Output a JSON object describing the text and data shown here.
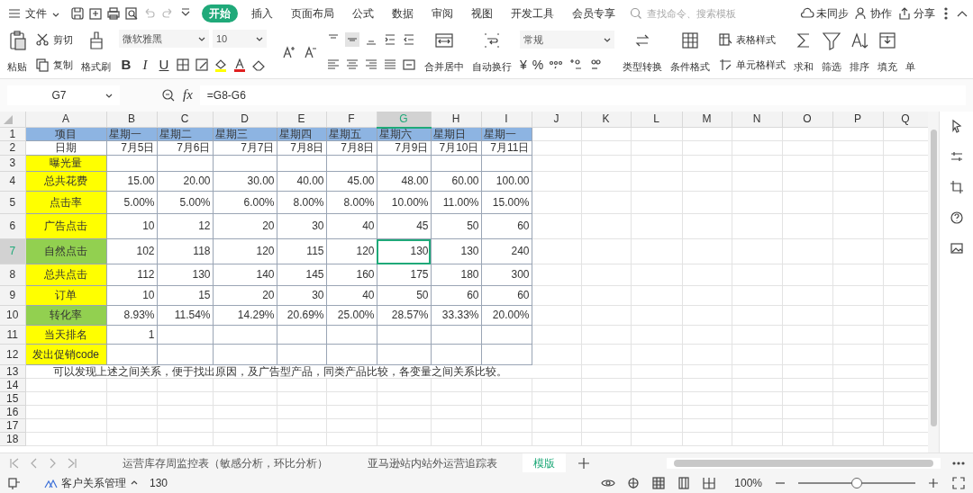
{
  "menu_bar": {
    "file": "文件",
    "tabs": [
      {
        "label": "开始",
        "selected": true
      },
      {
        "label": "插入",
        "selected": false
      },
      {
        "label": "页面布局",
        "selected": false
      },
      {
        "label": "公式",
        "selected": false
      },
      {
        "label": "数据",
        "selected": false
      },
      {
        "label": "审阅",
        "selected": false
      },
      {
        "label": "视图",
        "selected": false
      },
      {
        "label": "开发工具",
        "selected": false
      },
      {
        "label": "会员专享",
        "selected": false
      }
    ],
    "search": {
      "placeholder": "查找命令、搜索模板"
    },
    "actions": [
      "未同步",
      "协作",
      "分享"
    ]
  },
  "ribbon": {
    "paste": "粘贴",
    "cut": "剪切",
    "copy": "复制",
    "format_painter": "格式刷",
    "font_name": "微软雅黑",
    "font_size": "10",
    "bold": "B",
    "italic": "I",
    "underline": "U",
    "merge": "合并居中",
    "wrap": "自动换行",
    "number_format": "常规",
    "currency": "¥",
    "percent": "%",
    "convert": "类型转换",
    "conditional_format": "条件格式",
    "table_style": "表格样式",
    "cell_style": "单元格样式",
    "sum": "求和",
    "filter": "筛选",
    "sort": "排序",
    "fill": "填充",
    "more": "单"
  },
  "formula_bar": {
    "name_box": "G7",
    "fx": "fx",
    "formula": "=G8-G6"
  },
  "columns": [
    {
      "label": "A",
      "selected": false
    },
    {
      "label": "B",
      "selected": false
    },
    {
      "label": "C",
      "selected": false
    },
    {
      "label": "D",
      "selected": false
    },
    {
      "label": "E",
      "selected": false
    },
    {
      "label": "F",
      "selected": false
    },
    {
      "label": "G",
      "selected": true
    },
    {
      "label": "H",
      "selected": false
    },
    {
      "label": "I",
      "selected": false
    },
    {
      "label": "J",
      "selected": false
    },
    {
      "label": "K",
      "selected": false
    },
    {
      "label": "L",
      "selected": false
    },
    {
      "label": "M",
      "selected": false
    },
    {
      "label": "N",
      "selected": false
    },
    {
      "label": "O",
      "selected": false
    },
    {
      "label": "P",
      "selected": false
    },
    {
      "label": "Q",
      "selected": false
    }
  ],
  "rows": [
    {
      "label": "1",
      "selected": false,
      "cells": [
        {
          "text": "项目",
          "color": "#8db4e2"
        },
        {
          "text": "星期一",
          "color": "#8db4e2"
        },
        {
          "text": "星期二",
          "color": "#8db4e2"
        },
        {
          "text": "星期三",
          "color": "#8db4e2"
        },
        {
          "text": "星期四",
          "color": "#8db4e2"
        },
        {
          "text": "星期五",
          "color": "#8db4e2"
        },
        {
          "text": "星期六",
          "color": "#8db4e2"
        },
        {
          "text": "星期日",
          "color": "#8db4e2"
        },
        {
          "text": "星期一",
          "color": "#8db4e2"
        }
      ]
    },
    {
      "label": "2",
      "selected": false,
      "cells": [
        {
          "text": "日期"
        },
        {
          "text": "7月5日"
        },
        {
          "text": "7月6日"
        },
        {
          "text": "7月7日"
        },
        {
          "text": "7月8日"
        },
        {
          "text": "7月8日"
        },
        {
          "text": "7月9日"
        },
        {
          "text": "7月10日"
        },
        {
          "text": "7月11日"
        }
      ]
    },
    {
      "label": "3",
      "selected": false,
      "cells": [
        {
          "text": "曝光量",
          "color": "#ffff00"
        }
      ]
    },
    {
      "label": "4",
      "selected": false,
      "cells": [
        {
          "text": "总共花费",
          "color": "#ffff00"
        },
        {
          "text": "15.00"
        },
        {
          "text": "20.00"
        },
        {
          "text": "30.00"
        },
        {
          "text": "40.00"
        },
        {
          "text": "45.00"
        },
        {
          "text": "48.00"
        },
        {
          "text": "60.00"
        },
        {
          "text": "100.00"
        }
      ]
    },
    {
      "label": "5",
      "selected": false,
      "cells": [
        {
          "text": "点击率",
          "color": "#ffff00"
        },
        {
          "text": "5.00%"
        },
        {
          "text": "5.00%"
        },
        {
          "text": "6.00%"
        },
        {
          "text": "8.00%"
        },
        {
          "text": "8.00%"
        },
        {
          "text": "10.00%"
        },
        {
          "text": "11.00%"
        },
        {
          "text": "15.00%"
        }
      ]
    },
    {
      "label": "6",
      "selected": false,
      "cells": [
        {
          "text": "广告点击",
          "color": "#ffff00"
        },
        {
          "text": "10"
        },
        {
          "text": "12"
        },
        {
          "text": "20"
        },
        {
          "text": "30"
        },
        {
          "text": "40"
        },
        {
          "text": "45"
        },
        {
          "text": "50"
        },
        {
          "text": "60"
        }
      ]
    },
    {
      "label": "7",
      "selected": true,
      "cells": [
        {
          "text": "自然点击",
          "color": "#92d050"
        },
        {
          "text": "102"
        },
        {
          "text": "118"
        },
        {
          "text": "120"
        },
        {
          "text": "115"
        },
        {
          "text": "120"
        },
        {
          "text": "130",
          "selected": true
        },
        {
          "text": "130"
        },
        {
          "text": "240"
        }
      ]
    },
    {
      "label": "8",
      "selected": false,
      "cells": [
        {
          "text": "总共点击",
          "color": "#ffff00"
        },
        {
          "text": "112"
        },
        {
          "text": "130"
        },
        {
          "text": "140"
        },
        {
          "text": "145"
        },
        {
          "text": "160"
        },
        {
          "text": "175"
        },
        {
          "text": "180"
        },
        {
          "text": "300"
        }
      ]
    },
    {
      "label": "9",
      "selected": false,
      "cells": [
        {
          "text": "订单",
          "color": "#ffff00"
        },
        {
          "text": "10"
        },
        {
          "text": "15"
        },
        {
          "text": "20"
        },
        {
          "text": "30"
        },
        {
          "text": "40"
        },
        {
          "text": "50"
        },
        {
          "text": "60"
        },
        {
          "text": "60"
        }
      ]
    },
    {
      "label": "10",
      "selected": false,
      "cells": [
        {
          "text": "转化率",
          "color": "#92d050"
        },
        {
          "text": "8.93%"
        },
        {
          "text": "11.54%"
        },
        {
          "text": "14.29%"
        },
        {
          "text": "20.69%"
        },
        {
          "text": "25.00%"
        },
        {
          "text": "28.57%"
        },
        {
          "text": "33.33%"
        },
        {
          "text": "20.00%"
        }
      ]
    },
    {
      "label": "11",
      "selected": false,
      "cells": [
        {
          "text": "当天排名",
          "color": "#ffff00"
        },
        {
          "text": "1"
        }
      ]
    },
    {
      "label": "12",
      "selected": false,
      "cells": [
        {
          "text": "发出促销code",
          "color": "#ffff00"
        }
      ]
    },
    {
      "label": "13",
      "selected": false,
      "note": "可以发现上述之间关系，便于找出原因，及广告型产品，同类产品比较，各变量之间关系比较。",
      "cells": []
    },
    {
      "label": "14",
      "selected": false,
      "cells": []
    },
    {
      "label": "15",
      "selected": false,
      "cells": []
    },
    {
      "label": "16",
      "selected": false,
      "cells": []
    },
    {
      "label": "17",
      "selected": false,
      "cells": []
    },
    {
      "label": "18",
      "selected": false,
      "cells": []
    }
  ],
  "sheet_tabs": [
    {
      "label": "运营库存周监控表（敏感分析，环比分析）",
      "selected": false
    },
    {
      "label": "亚马逊站内站外运营追踪表",
      "selected": false
    },
    {
      "label": "模版",
      "selected": true
    }
  ],
  "status_bar": {
    "macro": "客户关系管理",
    "count": "130",
    "zoom": "100%",
    "zoom_level": {
      "level": 0.5
    }
  }
}
